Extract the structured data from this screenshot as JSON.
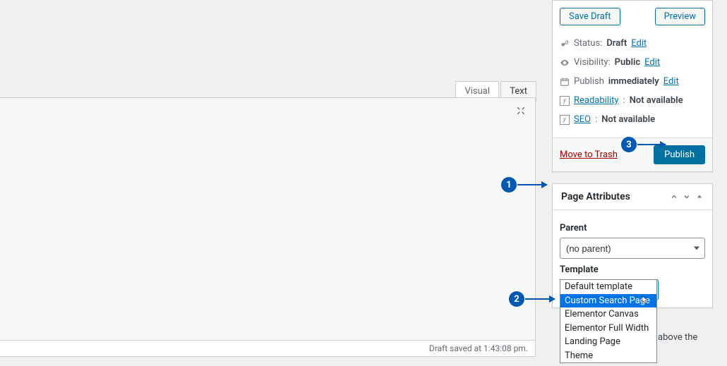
{
  "editor": {
    "tabs": {
      "visual": "Visual",
      "text": "Text"
    },
    "status_bar": "Draft saved at 1:43:08 pm."
  },
  "publish_panel": {
    "save_draft": "Save Draft",
    "preview": "Preview",
    "status_label": "Status:",
    "status_value": "Draft",
    "status_edit": "Edit",
    "visibility_label": "Visibility:",
    "visibility_value": "Public",
    "visibility_edit": "Edit",
    "schedule_label": "Publish",
    "schedule_value": "immediately",
    "schedule_edit": "Edit",
    "readability_label": "Readability",
    "readability_value": "Not available",
    "seo_label": "SEO",
    "seo_value": "Not available",
    "trash": "Move to Trash",
    "publish": "Publish"
  },
  "page_attributes": {
    "title": "Page Attributes",
    "parent_label": "Parent",
    "parent_value": "(no parent)",
    "template_label": "Template",
    "template_value": "Default template",
    "template_options": [
      "Default template",
      "Custom Search Page",
      "Elementor Canvas",
      "Elementor Full Width",
      "Landing Page",
      "Theme"
    ],
    "template_selected_index": 1,
    "hint_tail": "above the"
  },
  "callouts": {
    "one": "1",
    "two": "2",
    "three": "3"
  }
}
